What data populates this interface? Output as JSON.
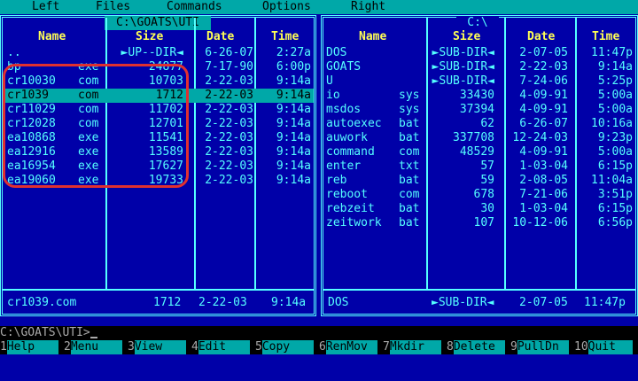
{
  "menu": [
    "Left",
    "Files",
    "Commands",
    "Options",
    "Right"
  ],
  "left_panel": {
    "title": "C:\\GOATS\\UTI",
    "headers": {
      "name": "Name",
      "size": "Size",
      "date": "Date",
      "time": "Time"
    },
    "rows": [
      {
        "name": "..",
        "ext": "",
        "size": "►UP--DIR◄",
        "date": "6-26-07",
        "time": "2:27a"
      },
      {
        "name": "bp",
        "ext": "exe",
        "size": "24877",
        "date": "7-17-90",
        "time": "6:00p"
      },
      {
        "name": "cr10030",
        "ext": "com",
        "size": "10703",
        "date": "2-22-03",
        "time": "9:14a"
      },
      {
        "name": "cr1039",
        "ext": "com",
        "size": "1712",
        "date": "2-22-03",
        "time": "9:14a"
      },
      {
        "name": "cr11029",
        "ext": "com",
        "size": "11702",
        "date": "2-22-03",
        "time": "9:14a"
      },
      {
        "name": "cr12028",
        "ext": "com",
        "size": "12701",
        "date": "2-22-03",
        "time": "9:14a"
      },
      {
        "name": "ea10868",
        "ext": "exe",
        "size": "11541",
        "date": "2-22-03",
        "time": "9:14a"
      },
      {
        "name": "ea12916",
        "ext": "exe",
        "size": "13589",
        "date": "2-22-03",
        "time": "9:14a"
      },
      {
        "name": "ea16954",
        "ext": "exe",
        "size": "17627",
        "date": "2-22-03",
        "time": "9:14a"
      },
      {
        "name": "ea19060",
        "ext": "exe",
        "size": "19733",
        "date": "2-22-03",
        "time": "9:14a"
      }
    ],
    "status": {
      "name": "cr1039.com",
      "size": "1712",
      "date": "2-22-03",
      "time": "9:14a"
    }
  },
  "right_panel": {
    "title": "C:\\",
    "headers": {
      "name": "Name",
      "size": "Size",
      "date": "Date",
      "time": "Time"
    },
    "rows": [
      {
        "name": "DOS",
        "ext": "",
        "size": "►SUB-DIR◄",
        "date": "2-07-05",
        "time": "11:47p"
      },
      {
        "name": "GOATS",
        "ext": "",
        "size": "►SUB-DIR◄",
        "date": "2-22-03",
        "time": "9:14a"
      },
      {
        "name": "U",
        "ext": "",
        "size": "►SUB-DIR◄",
        "date": "7-24-06",
        "time": "5:25p"
      },
      {
        "name": "io",
        "ext": "sys",
        "size": "33430",
        "date": "4-09-91",
        "time": "5:00a"
      },
      {
        "name": "msdos",
        "ext": "sys",
        "size": "37394",
        "date": "4-09-91",
        "time": "5:00a"
      },
      {
        "name": "autoexec",
        "ext": "bat",
        "size": "62",
        "date": "6-26-07",
        "time": "10:16a"
      },
      {
        "name": "auwork",
        "ext": "bat",
        "size": "337708",
        "date": "12-24-03",
        "time": "9:23p"
      },
      {
        "name": "command",
        "ext": "com",
        "size": "48529",
        "date": "4-09-91",
        "time": "5:00a"
      },
      {
        "name": "enter",
        "ext": "txt",
        "size": "57",
        "date": "1-03-04",
        "time": "6:15p"
      },
      {
        "name": "reb",
        "ext": "bat",
        "size": "59",
        "date": "2-08-05",
        "time": "11:04a"
      },
      {
        "name": "reboot",
        "ext": "com",
        "size": "678",
        "date": "7-21-06",
        "time": "3:51p"
      },
      {
        "name": "rebzeit",
        "ext": "bat",
        "size": "30",
        "date": "1-03-04",
        "time": "6:15p"
      },
      {
        "name": "zeitwork",
        "ext": "bat",
        "size": "107",
        "date": "10-12-06",
        "time": "6:56p"
      }
    ],
    "status": {
      "name": "DOS",
      "size": "►SUB-DIR◄",
      "date": "2-07-05",
      "time": "11:47p"
    }
  },
  "command_line": {
    "prompt": "C:\\GOATS\\UTI>"
  },
  "function_keys": [
    {
      "num": "1",
      "label": "Help"
    },
    {
      "num": "2",
      "label": "Menu"
    },
    {
      "num": "3",
      "label": "View"
    },
    {
      "num": "4",
      "label": "Edit"
    },
    {
      "num": "5",
      "label": "Copy"
    },
    {
      "num": "6",
      "label": "RenMov"
    },
    {
      "num": "7",
      "label": "Mkdir"
    },
    {
      "num": "8",
      "label": "Delete"
    },
    {
      "num": "9",
      "label": "PullDn"
    },
    {
      "num": "10",
      "label": "Quit"
    }
  ],
  "colors": {
    "background": "#0000a8",
    "text": "#55ffff",
    "header": "#ffff55",
    "cursor_bar": "#00a8a8",
    "annotation_ring": "#e03030"
  }
}
